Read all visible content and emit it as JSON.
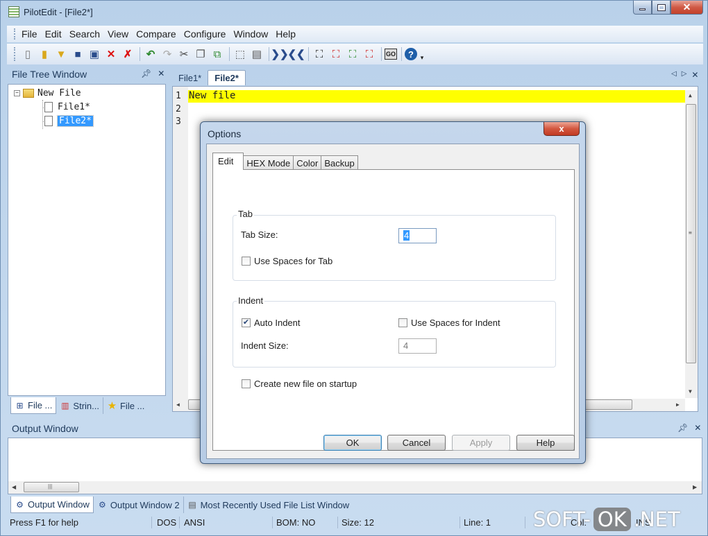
{
  "window": {
    "title": "PilotEdit - [File2*]"
  },
  "menu": [
    "File",
    "Edit",
    "Search",
    "View",
    "Compare",
    "Configure",
    "Window",
    "Help"
  ],
  "file_tree": {
    "title": "File Tree Window",
    "root": "New File",
    "items": [
      "File1*",
      "File2*"
    ],
    "selected": "File2*"
  },
  "left_tabs": [
    "File ...",
    "Strin...",
    "File ..."
  ],
  "editor": {
    "tabs": [
      "File1*",
      "File2*"
    ],
    "active_tab": "File2*",
    "line_numbers": [
      "1",
      "2",
      "3"
    ],
    "lines": [
      "New file",
      "",
      ""
    ],
    "highlight_color": "#ffff00"
  },
  "output": {
    "title": "Output Window",
    "tabs": [
      "Output Window",
      "Output Window 2",
      "Most Recently Used File List Window"
    ]
  },
  "statusbar": {
    "help": "Press F1 for help",
    "line_ending": "DOS",
    "encoding": "ANSI",
    "bom": "BOM: NO",
    "size": "Size: 12",
    "line": "Line: 1",
    "col": "Col:",
    "mode": "INS"
  },
  "dialog": {
    "title": "Options",
    "close_glyph": "x",
    "tabs": [
      "Edit",
      "HEX Mode",
      "Color",
      "Backup"
    ],
    "active_tab": "Edit",
    "tab_group": {
      "label": "Tab",
      "tab_size_label": "Tab Size:",
      "tab_size_value": "4",
      "use_spaces_label": "Use Spaces for Tab",
      "use_spaces_checked": false
    },
    "indent_group": {
      "label": "Indent",
      "auto_indent_label": "Auto Indent",
      "auto_indent_checked": true,
      "use_spaces_label": "Use Spaces for Indent",
      "use_spaces_checked": false,
      "indent_size_label": "Indent Size:",
      "indent_size_value": "4"
    },
    "startup_label": "Create new file on startup",
    "startup_checked": false,
    "buttons": {
      "ok": "OK",
      "cancel": "Cancel",
      "apply": "Apply",
      "help": "Help"
    }
  },
  "watermark": {
    "left": "SOFT-",
    "box": "OK",
    "right": ".NET"
  }
}
